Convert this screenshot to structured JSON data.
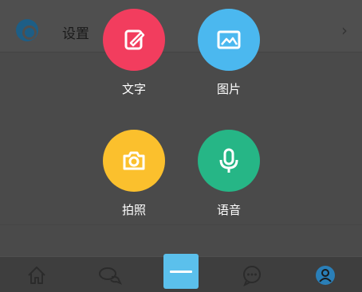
{
  "background": {
    "settings_row": {
      "label": "设置",
      "icon": "gear-icon",
      "chevron": "chevron-right-icon"
    }
  },
  "actions": [
    {
      "id": "text",
      "label": "文字",
      "icon": "edit-icon",
      "color": "#f23d5e"
    },
    {
      "id": "image",
      "label": "图片",
      "icon": "image-icon",
      "color": "#4bb8ef"
    },
    {
      "id": "photo",
      "label": "拍照",
      "icon": "camera-icon",
      "color": "#fbc02d"
    },
    {
      "id": "voice",
      "label": "语音",
      "icon": "microphone-icon",
      "color": "#26b686"
    }
  ],
  "tabbar": {
    "items": [
      {
        "icon": "home-icon"
      },
      {
        "icon": "chat-bubbles-icon"
      },
      {
        "icon": "close-menu-icon",
        "color": "#5bc0ec"
      },
      {
        "icon": "message-icon"
      },
      {
        "icon": "profile-icon",
        "color": "#2a7fb8"
      }
    ]
  }
}
